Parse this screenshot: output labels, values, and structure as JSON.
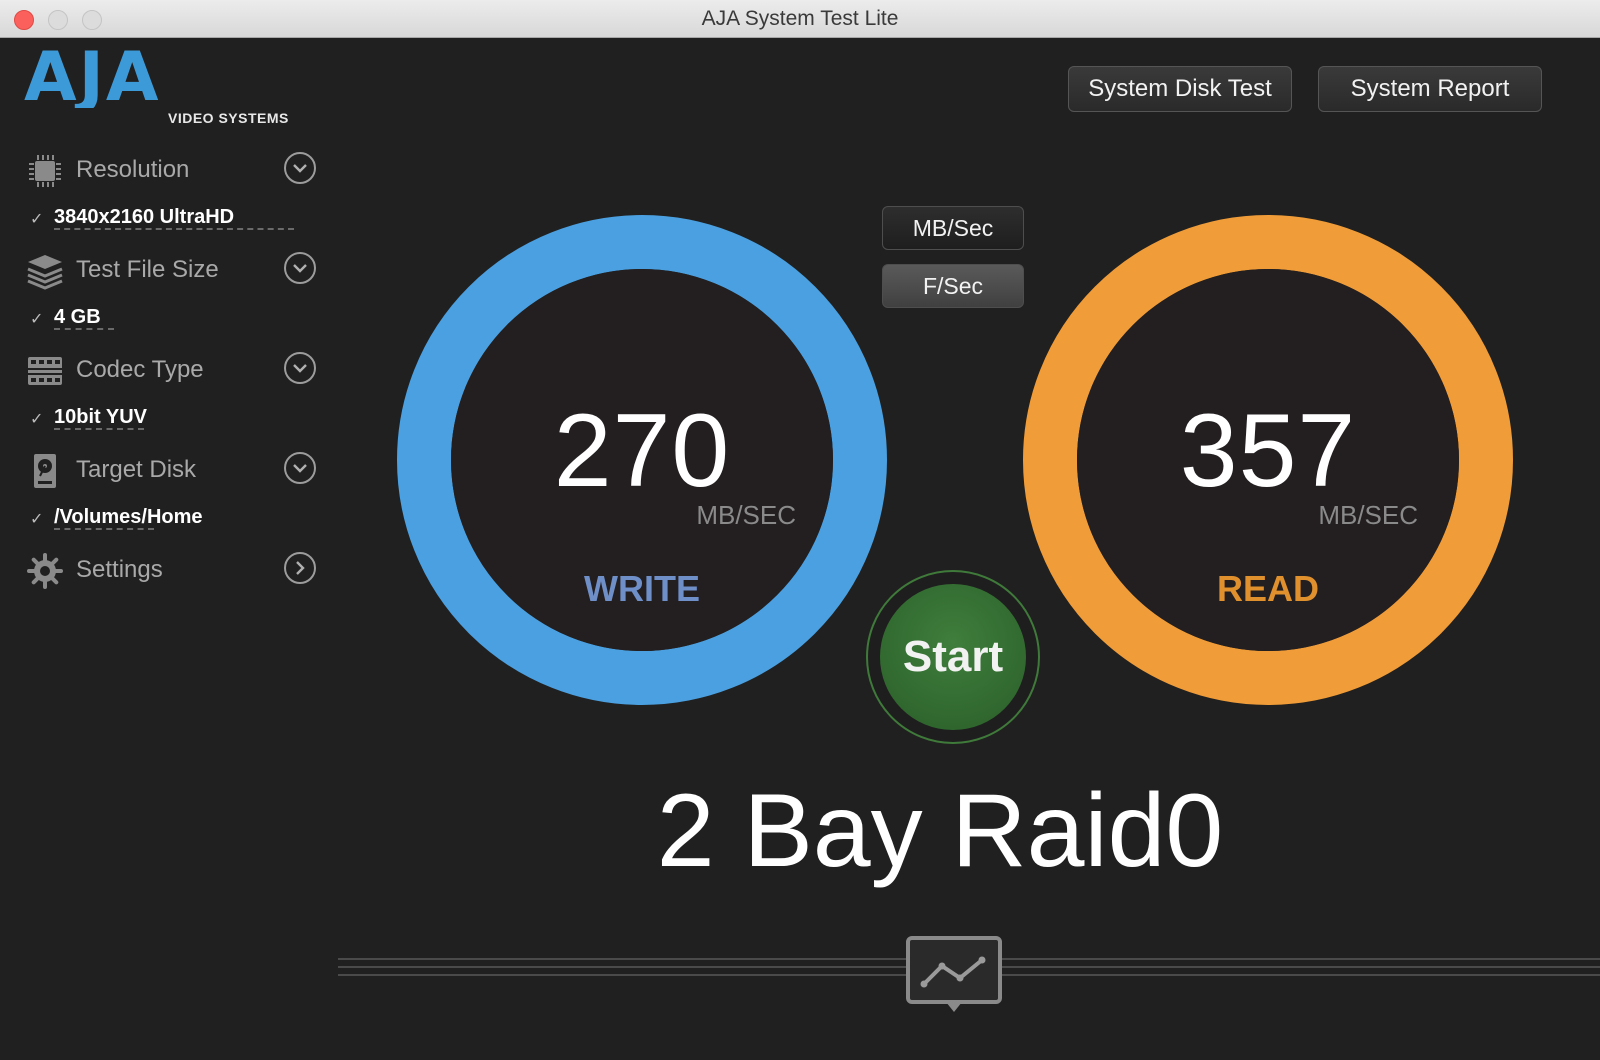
{
  "window": {
    "title": "AJA System Test Lite"
  },
  "logo": {
    "text": "AJA",
    "subtitle": "VIDEO SYSTEMS"
  },
  "toolbar": {
    "system_disk_test_label": "System Disk Test",
    "system_report_label": "System Report"
  },
  "sidebar": {
    "resolution": {
      "label": "Resolution",
      "value": "3840x2160 UltraHD"
    },
    "file_size": {
      "label": "Test File Size",
      "value": "4 GB"
    },
    "codec": {
      "label": "Codec Type",
      "value": "10bit YUV"
    },
    "target": {
      "label": "Target Disk",
      "value": "/Volumes/Home"
    },
    "settings": {
      "label": "Settings"
    }
  },
  "units": {
    "mb_label": "MB/Sec",
    "fs_label": "F/Sec"
  },
  "write": {
    "value": "270",
    "unit": "MB/SEC",
    "label": "WRITE",
    "color": "#4aa0e0"
  },
  "read": {
    "value": "357",
    "unit": "MB/SEC",
    "label": "READ",
    "color": "#f09c38"
  },
  "start": {
    "label": "Start"
  },
  "disk": {
    "name": "2 Bay Raid0"
  },
  "colors": {
    "background": "#202020",
    "write_label": "#6f8fc8",
    "read_label": "#e0912e",
    "start_green": "#2f6a2d",
    "logo_blue": "#3d9ad9"
  }
}
